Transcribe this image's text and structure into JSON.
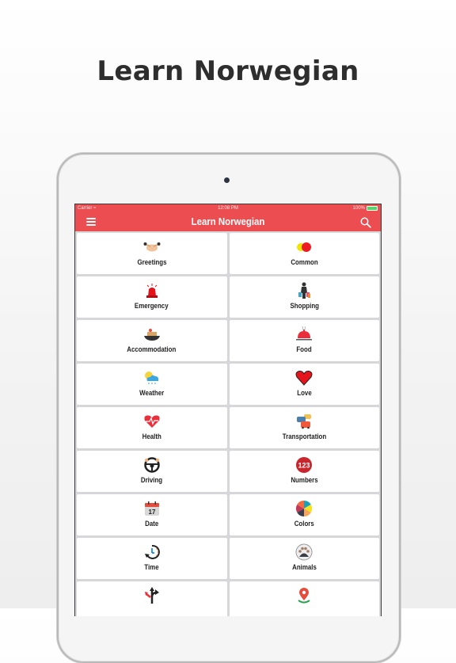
{
  "promo": {
    "title": "Learn Norwegian"
  },
  "statusbar": {
    "carrier": "Carrier",
    "time": "12:08 PM",
    "battery": "100%"
  },
  "navbar": {
    "title": "Learn Norwegian",
    "menu_icon": "hamburger-menu-icon",
    "search_icon": "search-icon"
  },
  "colors": {
    "accent": "#ec4d51",
    "grid_bg": "#d7d7d9",
    "cell_bg": "#ffffff"
  },
  "categories": [
    {
      "label": "Greetings",
      "icon": "handshake-icon"
    },
    {
      "label": "Common",
      "icon": "overlapping-circles-icon"
    },
    {
      "label": "Emergency",
      "icon": "siren-icon"
    },
    {
      "label": "Shopping",
      "icon": "shopper-bags-icon"
    },
    {
      "label": "Accommodation",
      "icon": "hotel-bed-icon"
    },
    {
      "label": "Food",
      "icon": "food-cloche-icon"
    },
    {
      "label": "Weather",
      "icon": "sun-cloud-rain-icon"
    },
    {
      "label": "Love",
      "icon": "heart-icon"
    },
    {
      "label": "Health",
      "icon": "heartbeat-icon"
    },
    {
      "label": "Transportation",
      "icon": "cars-icon"
    },
    {
      "label": "Driving",
      "icon": "steering-wheel-icon"
    },
    {
      "label": "Numbers",
      "icon": "numbers-123-icon"
    },
    {
      "label": "Date",
      "icon": "calendar-icon",
      "icon_text": "17"
    },
    {
      "label": "Colors",
      "icon": "color-palette-icon"
    },
    {
      "label": "Time",
      "icon": "clock-rewind-icon"
    },
    {
      "label": "Animals",
      "icon": "paw-icon"
    },
    {
      "label": "",
      "icon": "direction-arrows-icon"
    },
    {
      "label": "",
      "icon": "map-pin-icon"
    }
  ]
}
